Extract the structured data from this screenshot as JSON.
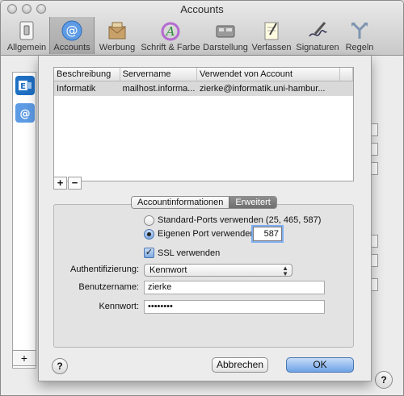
{
  "window": {
    "title": "Accounts"
  },
  "toolbar": {
    "items": [
      {
        "label": "Allgemein",
        "icon": "general-switch-icon"
      },
      {
        "label": "Accounts",
        "icon": "at-sign-icon"
      },
      {
        "label": "Werbung",
        "icon": "junk-mail-icon"
      },
      {
        "label": "Schrift & Farbe",
        "icon": "fonts-colors-icon"
      },
      {
        "label": "Darstellung",
        "icon": "viewing-icon"
      },
      {
        "label": "Verfassen",
        "icon": "composing-icon"
      },
      {
        "label": "Signaturen",
        "icon": "signature-pen-icon"
      },
      {
        "label": "Regeln",
        "icon": "rules-icon"
      }
    ],
    "active": "Accounts"
  },
  "background": {
    "add_label": "+",
    "help_label": "?"
  },
  "sheet": {
    "table": {
      "headers": [
        "Beschreibung",
        "Servername",
        "Verwendet von Account"
      ],
      "rows": [
        [
          "Informatik",
          "mailhost.informa...",
          "zierke@informatik.uni-hambur..."
        ]
      ]
    },
    "add_label": "+",
    "remove_label": "−",
    "tabs": [
      "Accountinformationen",
      "Erweitert"
    ],
    "selected_tab": "Erweitert",
    "ports": {
      "standard_label": "Standard-Ports verwenden (25, 465, 587)",
      "custom_label": "Eigenen Port verwenden:",
      "custom_value": "587",
      "selected": "custom"
    },
    "ssl": {
      "label": "SSL verwenden",
      "checked": true
    },
    "auth": {
      "label": "Authentifizierung:",
      "value": "Kennwort"
    },
    "username": {
      "label": "Benutzername:",
      "value": "zierke"
    },
    "password": {
      "label": "Kennwort:",
      "value": "••••••••"
    },
    "buttons": {
      "cancel": "Abbrechen",
      "ok": "OK",
      "help": "?"
    }
  }
}
